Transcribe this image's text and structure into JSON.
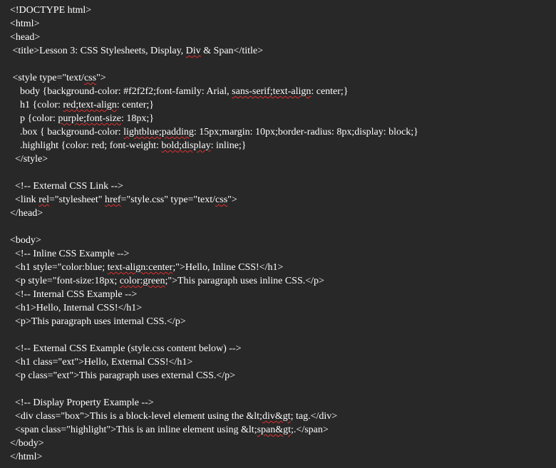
{
  "editor": {
    "background": "#282828",
    "text_color": "#ffffff",
    "spellcheck_color": "#e03030",
    "lines": [
      {
        "segments": [
          {
            "text": "<!DOCTYPE html>"
          }
        ]
      },
      {
        "segments": [
          {
            "text": "<html>"
          }
        ]
      },
      {
        "segments": [
          {
            "text": "<head>"
          }
        ]
      },
      {
        "segments": [
          {
            "text": " <title>Lesson 3: CSS Stylesheets, Display, "
          },
          {
            "text": "Div",
            "squig": true
          },
          {
            "text": " & Span</title>"
          }
        ]
      },
      {
        "segments": [
          {
            "text": ""
          }
        ]
      },
      {
        "segments": [
          {
            "text": " <style type=\"text/"
          },
          {
            "text": "css",
            "squig": true
          },
          {
            "text": "\">"
          }
        ]
      },
      {
        "segments": [
          {
            "text": "    body {background-color: #f2f2f2;font-family: Arial, "
          },
          {
            "text": "sans-serif;text-align",
            "squig": true
          },
          {
            "text": ": center;}"
          }
        ]
      },
      {
        "segments": [
          {
            "text": "    h1 {color: "
          },
          {
            "text": "red;text-align",
            "squig": true
          },
          {
            "text": ": center;}"
          }
        ]
      },
      {
        "segments": [
          {
            "text": "    p {color: "
          },
          {
            "text": "purple;font-size",
            "squig": true
          },
          {
            "text": ": 18px;}"
          }
        ]
      },
      {
        "segments": [
          {
            "text": "    .box { background-color: "
          },
          {
            "text": "lightblue;padding",
            "squig": true
          },
          {
            "text": ": 15px;margin: 10px;border-radius: 8px;display: block;}"
          }
        ]
      },
      {
        "segments": [
          {
            "text": "    .highlight {color: red; font-weight: "
          },
          {
            "text": "bold;display",
            "squig": true
          },
          {
            "text": ": inline;}"
          }
        ]
      },
      {
        "segments": [
          {
            "text": "  </style>"
          }
        ]
      },
      {
        "segments": [
          {
            "text": ""
          }
        ]
      },
      {
        "segments": [
          {
            "text": "  <!-- External CSS Link -->"
          }
        ]
      },
      {
        "segments": [
          {
            "text": "  <link "
          },
          {
            "text": "rel",
            "squig": true
          },
          {
            "text": "=\"stylesheet\" "
          },
          {
            "text": "href",
            "squig": true
          },
          {
            "text": "=\"style.css\" type=\"text/"
          },
          {
            "text": "css",
            "squig": true
          },
          {
            "text": "\">"
          }
        ]
      },
      {
        "segments": [
          {
            "text": "</head>"
          }
        ]
      },
      {
        "segments": [
          {
            "text": ""
          }
        ]
      },
      {
        "segments": [
          {
            "text": "<body>"
          }
        ]
      },
      {
        "segments": [
          {
            "text": "  <!-- Inline CSS Example -->"
          }
        ]
      },
      {
        "segments": [
          {
            "text": "  <h1 style=\"color:blue; "
          },
          {
            "text": "text-align:center",
            "squig": true
          },
          {
            "text": ";\">Hello, Inline CSS!</h1>"
          }
        ]
      },
      {
        "segments": [
          {
            "text": "  <p style=\"font-size:18px; "
          },
          {
            "text": "color:green",
            "squig": true
          },
          {
            "text": ";\">This paragraph uses inline CSS.</p>"
          }
        ]
      },
      {
        "segments": [
          {
            "text": "  <!-- Internal CSS Example -->"
          }
        ]
      },
      {
        "segments": [
          {
            "text": "  <h1>Hello, Internal CSS!</h1>"
          }
        ]
      },
      {
        "segments": [
          {
            "text": "  <p>This paragraph uses internal CSS.</p>"
          }
        ]
      },
      {
        "segments": [
          {
            "text": ""
          }
        ]
      },
      {
        "segments": [
          {
            "text": "  <!-- External CSS Example (style.css content below) -->"
          }
        ]
      },
      {
        "segments": [
          {
            "text": "  <h1 class=\"ext\">Hello, External CSS!</h1>"
          }
        ]
      },
      {
        "segments": [
          {
            "text": "  <p class=\"ext\">This paragraph uses external CSS.</p>"
          }
        ]
      },
      {
        "segments": [
          {
            "text": ""
          }
        ]
      },
      {
        "segments": [
          {
            "text": "  <!-- Display Property Example -->"
          }
        ]
      },
      {
        "segments": [
          {
            "text": "  <div class=\"box\">This is a block-level element using the &lt;"
          },
          {
            "text": "div&gt",
            "squig": true
          },
          {
            "text": "; tag.</div>"
          }
        ]
      },
      {
        "segments": [
          {
            "text": "  <span class=\"highlight\">This is an inline element using &lt;"
          },
          {
            "text": "span&gt",
            "squig": true
          },
          {
            "text": ";.</span>"
          }
        ]
      },
      {
        "segments": [
          {
            "text": "</body>"
          }
        ]
      },
      {
        "segments": [
          {
            "text": "</html>"
          }
        ]
      }
    ]
  }
}
